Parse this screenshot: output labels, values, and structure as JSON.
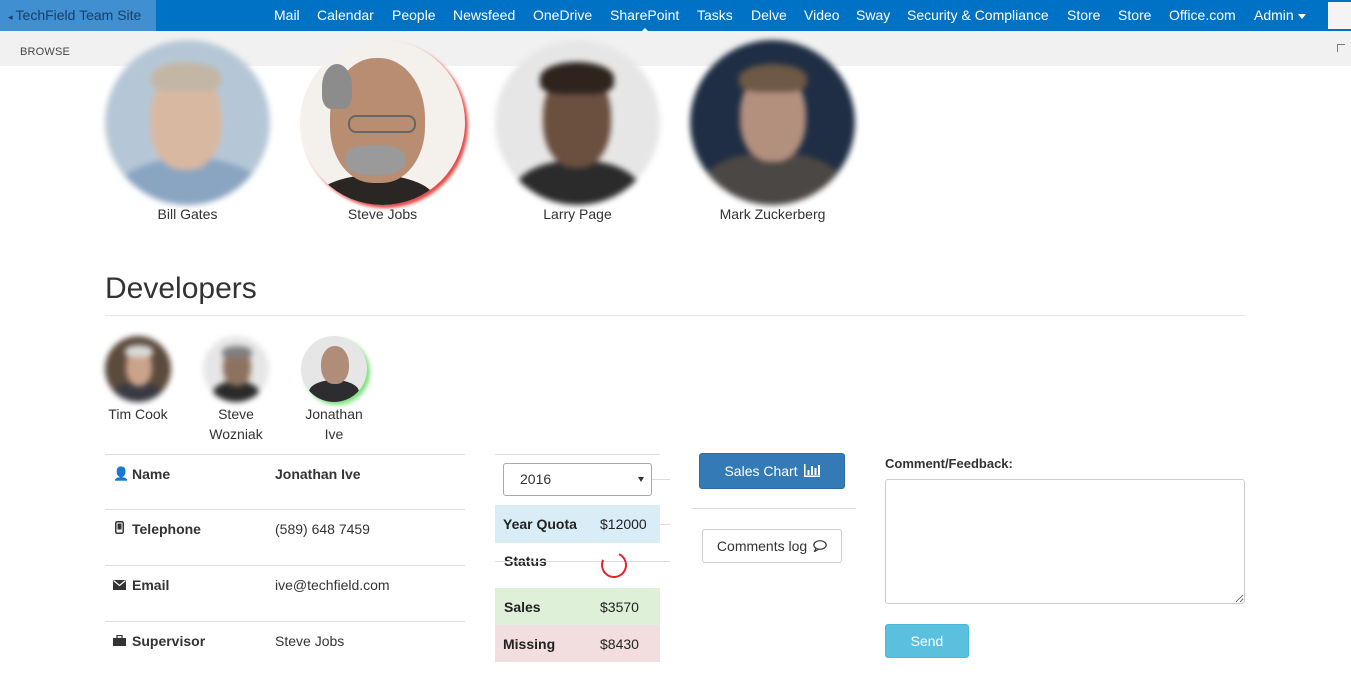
{
  "suitebar": {
    "site_link": "TechField Team Site",
    "nav": [
      "Mail",
      "Calendar",
      "People",
      "Newsfeed",
      "OneDrive",
      "SharePoint",
      "Tasks",
      "Delve",
      "Video",
      "Sway",
      "Security & Compliance",
      "Store",
      "Store",
      "Office.com"
    ],
    "active": "SharePoint",
    "admin": "Admin",
    "brand_color": "#0072c6"
  },
  "ribbon": {
    "browse": "BROWSE"
  },
  "executives": [
    {
      "name": "Bill Gates",
      "highlight": "none"
    },
    {
      "name": "Steve Jobs",
      "highlight": "red"
    },
    {
      "name": "Larry Page",
      "highlight": "none"
    },
    {
      "name": "Mark Zuckerberg",
      "highlight": "none"
    }
  ],
  "developers_section": {
    "title": "Developers",
    "people": [
      {
        "name": "Tim Cook",
        "highlight": "none"
      },
      {
        "name": "Steve Wozniak",
        "highlight": "none"
      },
      {
        "name": "Jonathan Ive",
        "highlight": "green"
      }
    ]
  },
  "details": {
    "name_label": "Name",
    "name_value": "Jonathan Ive",
    "phone_label": "Telephone",
    "phone_value": "(589) 648 7459",
    "email_label": "Email",
    "email_value": "ive@techfield.com",
    "supervisor_label": "Supervisor",
    "supervisor_value": "Steve Jobs"
  },
  "quota": {
    "year": "2016",
    "year_quota_label": "Year Quota",
    "year_quota_value": "$12000",
    "status_label": "Status",
    "sales_label": "Sales",
    "sales_value": "$3570",
    "missing_label": "Missing",
    "missing_value": "$8430",
    "colors": {
      "info": "#d9edf7",
      "success": "#dff0d8",
      "danger": "#f2dede"
    }
  },
  "actions": {
    "sales_chart": "Sales Chart",
    "comments_log": "Comments log"
  },
  "feedback": {
    "label": "Comment/Feedback:",
    "value": "",
    "send": "Send"
  }
}
